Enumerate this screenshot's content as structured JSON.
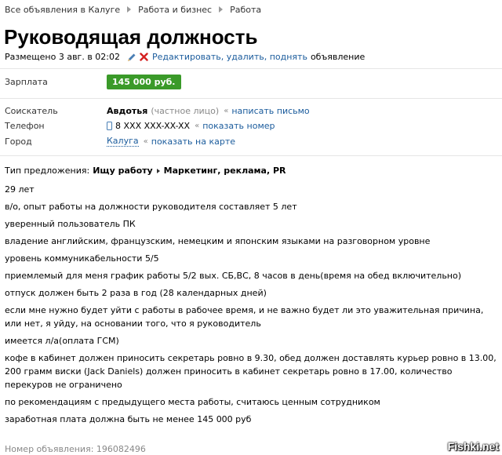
{
  "breadcrumb": [
    "Все объявления в Калуге",
    "Работа и бизнес",
    "Работа"
  ],
  "title": "Руководящая должность",
  "meta": {
    "posted": "Размещено 3 авг. в 02:02",
    "edit_link": "Редактировать, удалить, поднять",
    "edit_suffix": "объявление"
  },
  "salary": {
    "label": "Зарплата",
    "value": "145 000 руб."
  },
  "applicant": {
    "label": "Соискатель",
    "name": "Авдотья",
    "type": "(частное лицо)",
    "write_link": "написать письмо"
  },
  "phone": {
    "label": "Телефон",
    "value": "8 XXX XXX-XX-XX",
    "show_link": "показать номер"
  },
  "city": {
    "label": "Город",
    "value": "Калуга",
    "map_link": "показать на карте"
  },
  "offer": {
    "label": "Тип предложения:",
    "type": "Ищу работу",
    "category": "Маркетинг, реклама, PR"
  },
  "description": [
    "29 лет",
    "в/о, опыт работы на должности руководителя составляет 5 лет",
    "уверенный пользователь ПК",
    "владение английским, французским, немецким и японским языками на разговорном уровне",
    "уровень коммуникабельности 5/5",
    "приемлемый для меня график работы 5/2 вых. СБ,ВС, 8 часов в день(время на обед включительно)",
    "отпуск должен быть 2 раза в год (28 календарных дней)",
    "если мне нужно будет уйти с работы в рабочее время, и не важно будет ли это уважительная причина, или нет, я уйду, на основании того, что я руководитель",
    "имеется л/а(оплата ГСМ)",
    "кофе в кабинет должен приносить секретарь ровно в 9.30, обед должен доставлять курьер ровно в 13.00, 200 грамм виски (Jack Daniels) должен приносить в кабинет секретарь ровно в 17.00, количество перекуров не ограничено",
    "по рекомендациям с предыдущего места работы, считаюсь ценным сотрудником",
    "заработная плата должна быть не менее 145 000 руб"
  ],
  "ad_number": "Номер объявления: 196082496",
  "watermark": "Fishki.net",
  "colors": {
    "link": "#1a5b9c",
    "price_bg": "#3a9a29",
    "muted": "#888888"
  }
}
